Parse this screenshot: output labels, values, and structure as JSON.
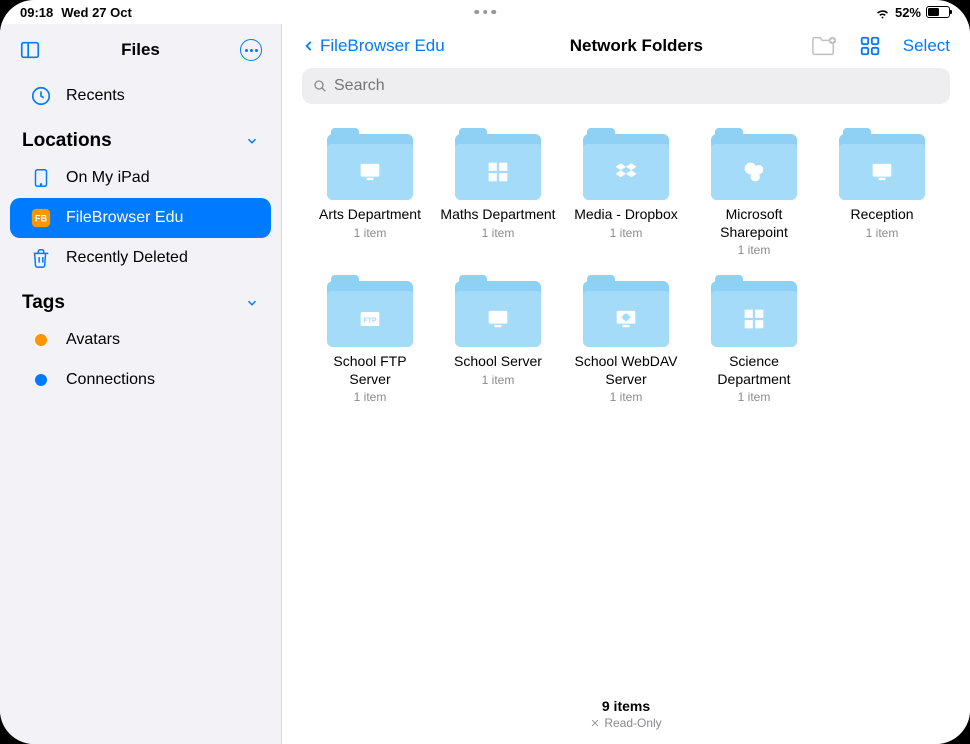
{
  "status": {
    "time": "09:18",
    "date": "Wed 27 Oct",
    "battery_pct": "52%"
  },
  "sidebar": {
    "title": "Files",
    "recents": "Recents",
    "sections": {
      "locations": "Locations",
      "tags": "Tags"
    },
    "locations": [
      {
        "label": "On My iPad",
        "icon": "ipad"
      },
      {
        "label": "FileBrowser Edu",
        "icon": "fb",
        "selected": true
      },
      {
        "label": "Recently Deleted",
        "icon": "trash"
      }
    ],
    "tags": [
      {
        "label": "Avatars",
        "color": "orange"
      },
      {
        "label": "Connections",
        "color": "blue"
      }
    ]
  },
  "main": {
    "back_label": "FileBrowser Edu",
    "title": "Network Folders",
    "select_label": "Select",
    "search_placeholder": "Search",
    "folders": [
      {
        "name": "Arts Department",
        "sub": "1 item",
        "glyph": "monitor"
      },
      {
        "name": "Maths Department",
        "sub": "1 item",
        "glyph": "windows"
      },
      {
        "name": "Media - Dropbox",
        "sub": "1 item",
        "glyph": "dropbox"
      },
      {
        "name": "Microsoft Sharepoint",
        "sub": "1 item",
        "glyph": "sharepoint"
      },
      {
        "name": "Reception",
        "sub": "1 item",
        "glyph": "monitor"
      },
      {
        "name": "School FTP Server",
        "sub": "1 item",
        "glyph": "ftp"
      },
      {
        "name": "School Server",
        "sub": "1 item",
        "glyph": "monitor"
      },
      {
        "name": "School WebDAV Server",
        "sub": "1 item",
        "glyph": "webdav"
      },
      {
        "name": "Science Department",
        "sub": "1 item",
        "glyph": "windows"
      }
    ],
    "footer_count": "9 items",
    "footer_readonly": "Read-Only"
  }
}
